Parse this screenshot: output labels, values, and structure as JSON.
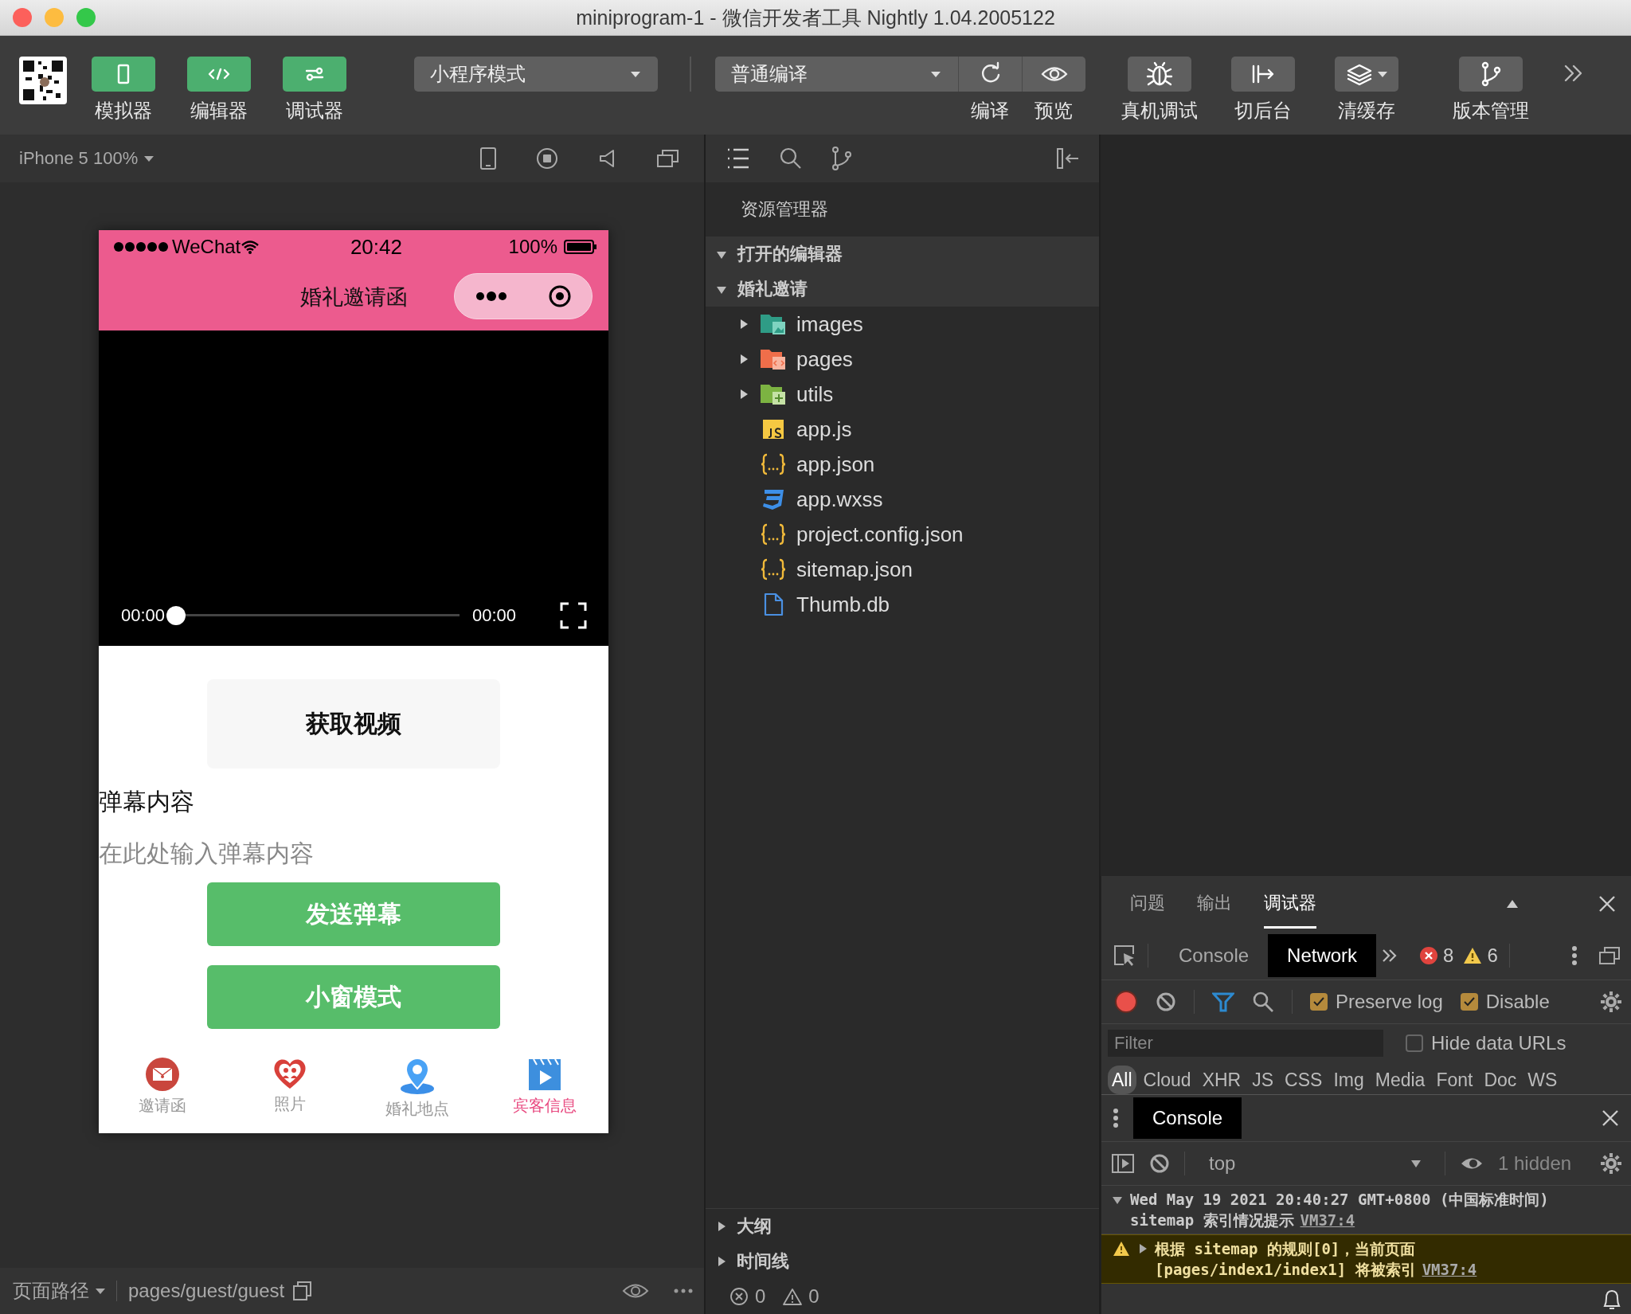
{
  "window": {
    "title": "miniprogram-1 - 微信开发者工具 Nightly 1.04.2005122"
  },
  "toolbar": {
    "toggles": [
      {
        "label": "模拟器",
        "on": true
      },
      {
        "label": "编辑器",
        "on": true
      },
      {
        "label": "调试器",
        "on": true
      }
    ],
    "mode_select": "小程序模式",
    "compile_select": "普通编译",
    "compile_actions": [
      {
        "label": "编译"
      },
      {
        "label": "预览"
      }
    ],
    "tools": [
      {
        "label": "真机调试",
        "kind": "button"
      },
      {
        "label": "切后台",
        "kind": "button"
      },
      {
        "label": "清缓存",
        "kind": "dropdown"
      },
      {
        "label": "版本管理",
        "kind": "button"
      }
    ]
  },
  "simulator": {
    "device": "iPhone 5 100%",
    "status_bar": {
      "carrier": "WeChat",
      "time": "20:42",
      "battery": "100%"
    },
    "nav_title": "婚礼邀请函",
    "video": {
      "current_time": "00:00",
      "duration": "00:00",
      "level": 0
    },
    "get_video_button": "获取视频",
    "danmu_label": "弹幕内容",
    "danmu_input": {
      "placeholder": "在此处输入弹幕内容"
    },
    "buttons": [
      "发送弹幕",
      "小窗模式"
    ],
    "tabbar": [
      {
        "label": "邀请函",
        "selected": false
      },
      {
        "label": "照片",
        "selected": false
      },
      {
        "label": "婚礼地点",
        "selected": false
      },
      {
        "label": "宾客信息",
        "selected": true
      }
    ],
    "path_bar": {
      "label": "页面路径",
      "path": "pages/guest/guest"
    }
  },
  "explorer": {
    "title": "资源管理器",
    "sections": [
      {
        "label": "打开的编辑器",
        "expanded": true
      },
      {
        "label": "婚礼邀请",
        "expanded": true,
        "children": [
          {
            "name": "images",
            "kind": "imagefolder",
            "expanded": false
          },
          {
            "name": "pages",
            "kind": "codefolder",
            "expanded": false
          },
          {
            "name": "utils",
            "kind": "libfolder",
            "expanded": false
          },
          {
            "name": "app.js",
            "kind": "js"
          },
          {
            "name": "app.json",
            "kind": "json"
          },
          {
            "name": "app.wxss",
            "kind": "css"
          },
          {
            "name": "project.config.json",
            "kind": "json"
          },
          {
            "name": "sitemap.json",
            "kind": "json"
          },
          {
            "name": "Thumb.db",
            "kind": "file"
          }
        ]
      }
    ],
    "bottom_sections": [
      {
        "label": "大纲",
        "expanded": false
      },
      {
        "label": "时间线",
        "expanded": false
      }
    ],
    "problems": {
      "errors": "0",
      "warnings": "0"
    }
  },
  "devtools": {
    "tabs": [
      {
        "label": "问题",
        "selected": false
      },
      {
        "label": "输出",
        "selected": false
      },
      {
        "label": "调试器",
        "selected": true
      }
    ],
    "panel_tabs": [
      {
        "label": "Console",
        "selected": false
      },
      {
        "label": "Network",
        "selected": true
      }
    ],
    "error_count": "8",
    "warning_count": "6",
    "options": [
      {
        "label": "Preserve log",
        "checked": true
      },
      {
        "label": "Disable",
        "checked": true
      }
    ],
    "filter": {
      "placeholder": "Filter"
    },
    "hide_data_urls": {
      "label": "Hide data URLs",
      "checked": false
    },
    "type_filters": [
      {
        "label": "All",
        "selected": true
      },
      {
        "label": "Cloud",
        "selected": false
      },
      {
        "label": "XHR",
        "selected": false
      },
      {
        "label": "JS",
        "selected": false
      },
      {
        "label": "CSS",
        "selected": false
      },
      {
        "label": "Img",
        "selected": false
      },
      {
        "label": "Media",
        "selected": false
      },
      {
        "label": "Font",
        "selected": false
      },
      {
        "label": "Doc",
        "selected": false
      },
      {
        "label": "WS",
        "selected": false
      }
    ],
    "drawer_tab": "Console",
    "context": "top",
    "hidden_count": "1 hidden",
    "messages": [
      {
        "kind": "info",
        "text": "Wed May 19 2021 20:40:27 GMT+0800 (中国标准时间) sitemap 索引情况提示",
        "source": "VM37:4"
      },
      {
        "kind": "warning",
        "text": "根据 sitemap 的规则[0]，当前页面 [pages/index1/index1] 将被索引",
        "source": "VM37:4"
      }
    ]
  }
}
